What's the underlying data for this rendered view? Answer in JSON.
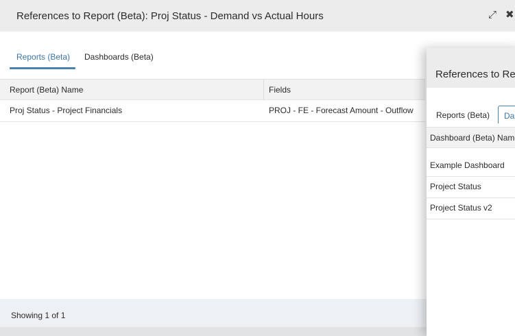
{
  "main_dialog": {
    "title": "References to Report (Beta): Proj Status - Demand vs Actual Hours",
    "expand_glyph": "⤢",
    "close_glyph": "✖",
    "tabs": [
      {
        "label": "Reports (Beta)",
        "active": true
      },
      {
        "label": "Dashboards (Beta)",
        "active": false
      }
    ],
    "table": {
      "columns": [
        "Report (Beta) Name",
        "Fields"
      ],
      "rows": [
        {
          "name": "Proj Status - Project Financials",
          "fields": "PROJ - FE - Forecast Amount - Outflow"
        }
      ]
    },
    "footer": "Showing 1 of 1"
  },
  "second_dialog": {
    "title": "References to Rep",
    "tabs": [
      {
        "label": "Reports (Beta)",
        "active": false
      },
      {
        "label": "Das",
        "active": true
      }
    ],
    "table": {
      "column": "Dashboard (Beta) Name",
      "rows": [
        "Example Dashboard",
        "Project Status",
        "Project Status v2"
      ]
    }
  },
  "colors": {
    "accent": "#4a80b2",
    "titlebar_bg": "#ececed",
    "footer_bg": "#eef1f4"
  }
}
